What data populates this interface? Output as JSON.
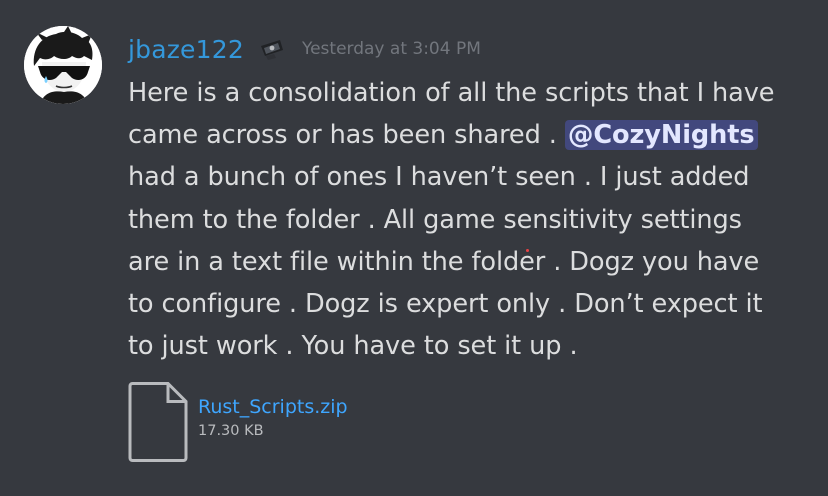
{
  "message": {
    "author": "jbaze122",
    "timestamp": "Yesterday at 3:04 PM",
    "lines": [
      {
        "text": "Here is a consolidation of all the scripts that I have"
      },
      {
        "before": "came across or has been shared . ",
        "mention": "@CozyNights"
      },
      {
        "text": "had a bunch of ones I haven’t seen .  I just added"
      },
      {
        "text": "them to the folder . All game sensitivity  settings"
      },
      {
        "before": "are in a text file within the folde",
        "after": "r . Dogz you have"
      },
      {
        "text": "to configure . Dogz is expert only . Don’t expect it"
      },
      {
        "text": "to just work . You have to set it up ."
      }
    ],
    "attachment": {
      "filename": "Rust_Scripts.zip",
      "size": "17.30 KB",
      "icon": "file-icon"
    }
  },
  "colors": {
    "background": "#36393f",
    "username": "#3498db",
    "timestamp": "#72767d",
    "text": "#dcddde",
    "mention_bg": "#5865f2",
    "link": "#3ea6ff"
  }
}
